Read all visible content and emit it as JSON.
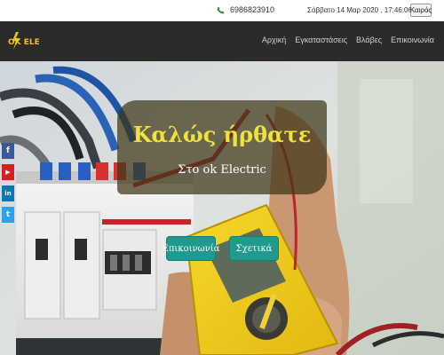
{
  "topbar": {
    "phone": "6986823910",
    "datetime": "Σάββατο 14 Μαρ 2020 , 17:46:06",
    "weather_button": "Καιρός"
  },
  "navbar": {
    "logo_text": "OK ELECTRIC",
    "items": [
      {
        "label": "Αρχική"
      },
      {
        "label": "Εγκαταστάσεις"
      },
      {
        "label": "Βλάβες"
      },
      {
        "label": "Επικοινωνία"
      }
    ]
  },
  "social": [
    {
      "icon": "facebook-icon",
      "glyph": "f",
      "color": "#3b5998"
    },
    {
      "icon": "youtube-icon",
      "glyph": "▶",
      "color": "#d62020"
    },
    {
      "icon": "linkedin-icon",
      "glyph": "in",
      "color": "#0a77b5"
    },
    {
      "icon": "twitter-icon",
      "glyph": "t",
      "color": "#2aa3ef"
    }
  ],
  "hero": {
    "title": "Καλώς ήρθατε",
    "subtitle": "Στο ok Electric",
    "buttons": [
      {
        "label": "Επικοινωνία"
      },
      {
        "label": "Σχετικά"
      }
    ]
  },
  "colors": {
    "accent": "#1f9a8d",
    "title": "#f1e23b",
    "navbar": "#2b2b2b"
  }
}
